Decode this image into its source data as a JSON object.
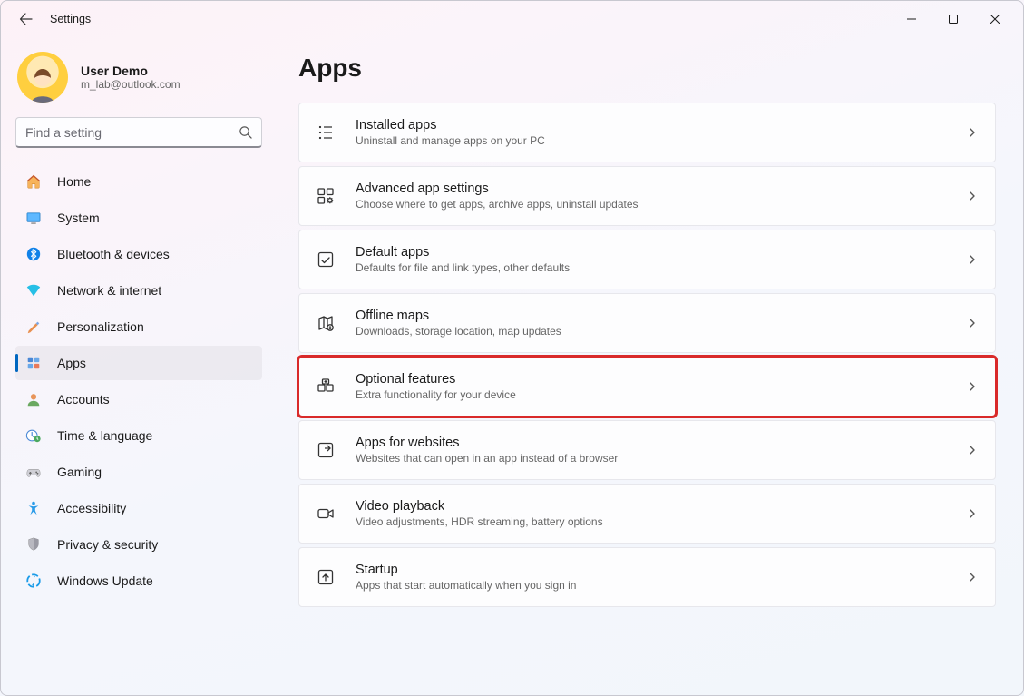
{
  "window": {
    "title": "Settings"
  },
  "account": {
    "name": "User Demo",
    "email": "m_lab@outlook.com"
  },
  "search": {
    "placeholder": "Find a setting"
  },
  "page_title": "Apps",
  "sidebar": {
    "items": [
      {
        "id": "home",
        "label": "Home",
        "selected": false
      },
      {
        "id": "system",
        "label": "System",
        "selected": false
      },
      {
        "id": "bluetooth",
        "label": "Bluetooth & devices",
        "selected": false
      },
      {
        "id": "network",
        "label": "Network & internet",
        "selected": false
      },
      {
        "id": "personalization",
        "label": "Personalization",
        "selected": false
      },
      {
        "id": "apps",
        "label": "Apps",
        "selected": true
      },
      {
        "id": "accounts",
        "label": "Accounts",
        "selected": false
      },
      {
        "id": "time",
        "label": "Time & language",
        "selected": false
      },
      {
        "id": "gaming",
        "label": "Gaming",
        "selected": false
      },
      {
        "id": "accessibility",
        "label": "Accessibility",
        "selected": false
      },
      {
        "id": "privacy",
        "label": "Privacy & security",
        "selected": false
      },
      {
        "id": "update",
        "label": "Windows Update",
        "selected": false
      }
    ]
  },
  "cards": [
    {
      "id": "installed",
      "title": "Installed apps",
      "desc": "Uninstall and manage apps on your PC",
      "highlight": false
    },
    {
      "id": "advanced",
      "title": "Advanced app settings",
      "desc": "Choose where to get apps, archive apps, uninstall updates",
      "highlight": false
    },
    {
      "id": "default",
      "title": "Default apps",
      "desc": "Defaults for file and link types, other defaults",
      "highlight": false
    },
    {
      "id": "offline",
      "title": "Offline maps",
      "desc": "Downloads, storage location, map updates",
      "highlight": false
    },
    {
      "id": "optional",
      "title": "Optional features",
      "desc": "Extra functionality for your device",
      "highlight": true
    },
    {
      "id": "websites",
      "title": "Apps for websites",
      "desc": "Websites that can open in an app instead of a browser",
      "highlight": false
    },
    {
      "id": "video",
      "title": "Video playback",
      "desc": "Video adjustments, HDR streaming, battery options",
      "highlight": false
    },
    {
      "id": "startup",
      "title": "Startup",
      "desc": "Apps that start automatically when you sign in",
      "highlight": false
    }
  ]
}
